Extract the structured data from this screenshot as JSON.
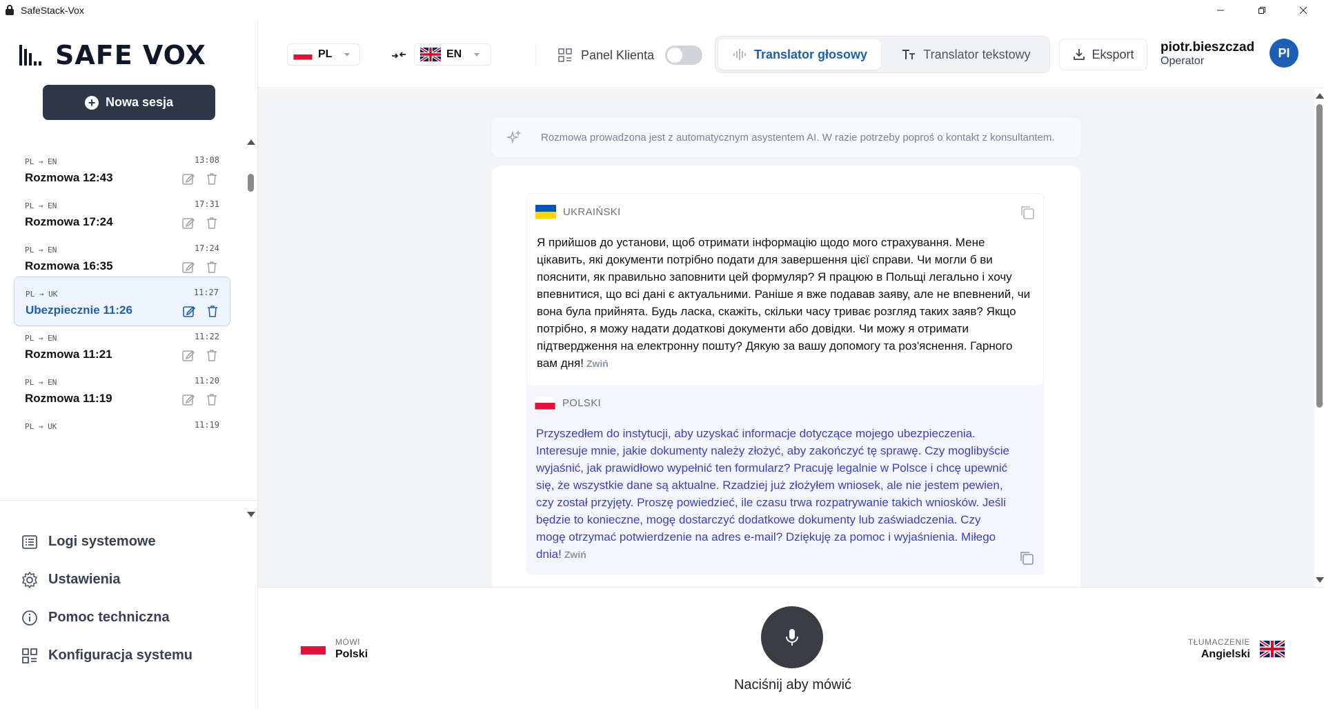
{
  "window": {
    "title": "SafeStack-Vox"
  },
  "brand": {
    "name": "SAFE VOX"
  },
  "sidebar": {
    "new_session_label": "Nowa sesja",
    "sessions": [
      {
        "langs": "PL → EN",
        "time": "13:08",
        "name": "Rozmowa 12:43",
        "active": false
      },
      {
        "langs": "PL → EN",
        "time": "17:31",
        "name": "Rozmowa 17:24",
        "active": false
      },
      {
        "langs": "PL → EN",
        "time": "17:24",
        "name": "Rozmowa 16:35",
        "active": false
      },
      {
        "langs": "PL → UK",
        "time": "11:27",
        "name": "Ubezpiecznie 11:26",
        "active": true
      },
      {
        "langs": "PL → EN",
        "time": "11:22",
        "name": "Rozmowa 11:21",
        "active": false
      },
      {
        "langs": "PL → EN",
        "time": "11:20",
        "name": "Rozmowa 11:19",
        "active": false
      },
      {
        "langs": "PL → UK",
        "time": "11:19",
        "name": "",
        "active": false
      }
    ],
    "nav": [
      {
        "label": "Logi systemowe",
        "icon": "list-icon"
      },
      {
        "label": "Ustawienia",
        "icon": "gear-icon"
      },
      {
        "label": "Pomoc techniczna",
        "icon": "info-icon"
      },
      {
        "label": "Konfiguracja systemu",
        "icon": "grid-config-icon"
      }
    ]
  },
  "header": {
    "source_lang": "PL",
    "target_lang": "EN",
    "panel_klienta_label": "Panel Klienta",
    "panel_klienta_on": false,
    "mode_voice": "Translator głosowy",
    "mode_text": "Translator tekstowy",
    "active_mode": "voice",
    "export_label": "Eksport",
    "user_name": "piotr.bieszczad",
    "user_role": "Operator",
    "avatar_initials": "PI"
  },
  "notice": "Rozmowa prowadzona jest z automatycznym asystentem AI. W razie potrzeby poproś o kontakt z konsultantem.",
  "messages": {
    "source": {
      "language": "UKRAIŃSKI",
      "text": "Я прийшов до установи, щоб отримати інформацію щодо мого страхування. Мене цікавить, які документи потрібно подати для завершення цієї справи. Чи могли б ви пояснити, як правильно заповнити цей формуляр? Я працюю в Польщі легально і хочу впевнитися, що всі дані є актуальними. Раніше я вже подавав заяву, але не впевнений, чи вона була прийнята. Будь ласка, скажіть, скільки часу триває розгляд таких заяв? Якщо потрібно, я можу надати додаткові документи або довідки. Чи можу я отримати підтвердження на електронну пошту? Дякую за вашу допомогу та роз'яснення. Гарного вам дня!",
      "collapse": "Zwiń"
    },
    "translation": {
      "language": "POLSKI",
      "text": "Przyszedłem do instytucji, aby uzyskać informacje dotyczące mojego ubezpieczenia. Interesuje mnie, jakie dokumenty należy złożyć, aby zakończyć tę sprawę. Czy moglibyście wyjaśnić, jak prawidłowo wypełnić ten formularz? Pracuję legalnie w Polsce i chcę upewnić się, że wszystkie dane są aktualne. Rzadziej już złożyłem wniosek, ale nie jestem pewien, czy został przyjęty. Proszę powiedzieć, ile czasu trwa rozpatrywanie takich wniosków. Jeśli będzie to konieczne, mogę dostarczyć dodatkowe dokumenty lub zaświadczenia. Czy mogę otrzymać potwierdzenie na adres e-mail? Dziękuję za pomoc i wyjaśnienia. Miłego dnia!",
      "collapse": "Zwiń"
    }
  },
  "footer": {
    "speaker_caption": "MÓWI",
    "speaker_lang": "Polski",
    "mic_label": "Naciśnij aby mówić",
    "translation_caption": "TŁUMACZENIE",
    "translation_lang": "Angielski"
  },
  "colors": {
    "accent": "#1d5fb3",
    "dark_button": "#2d3748",
    "translation_text": "#3a3fc7",
    "mic_button": "#3a3d44"
  }
}
